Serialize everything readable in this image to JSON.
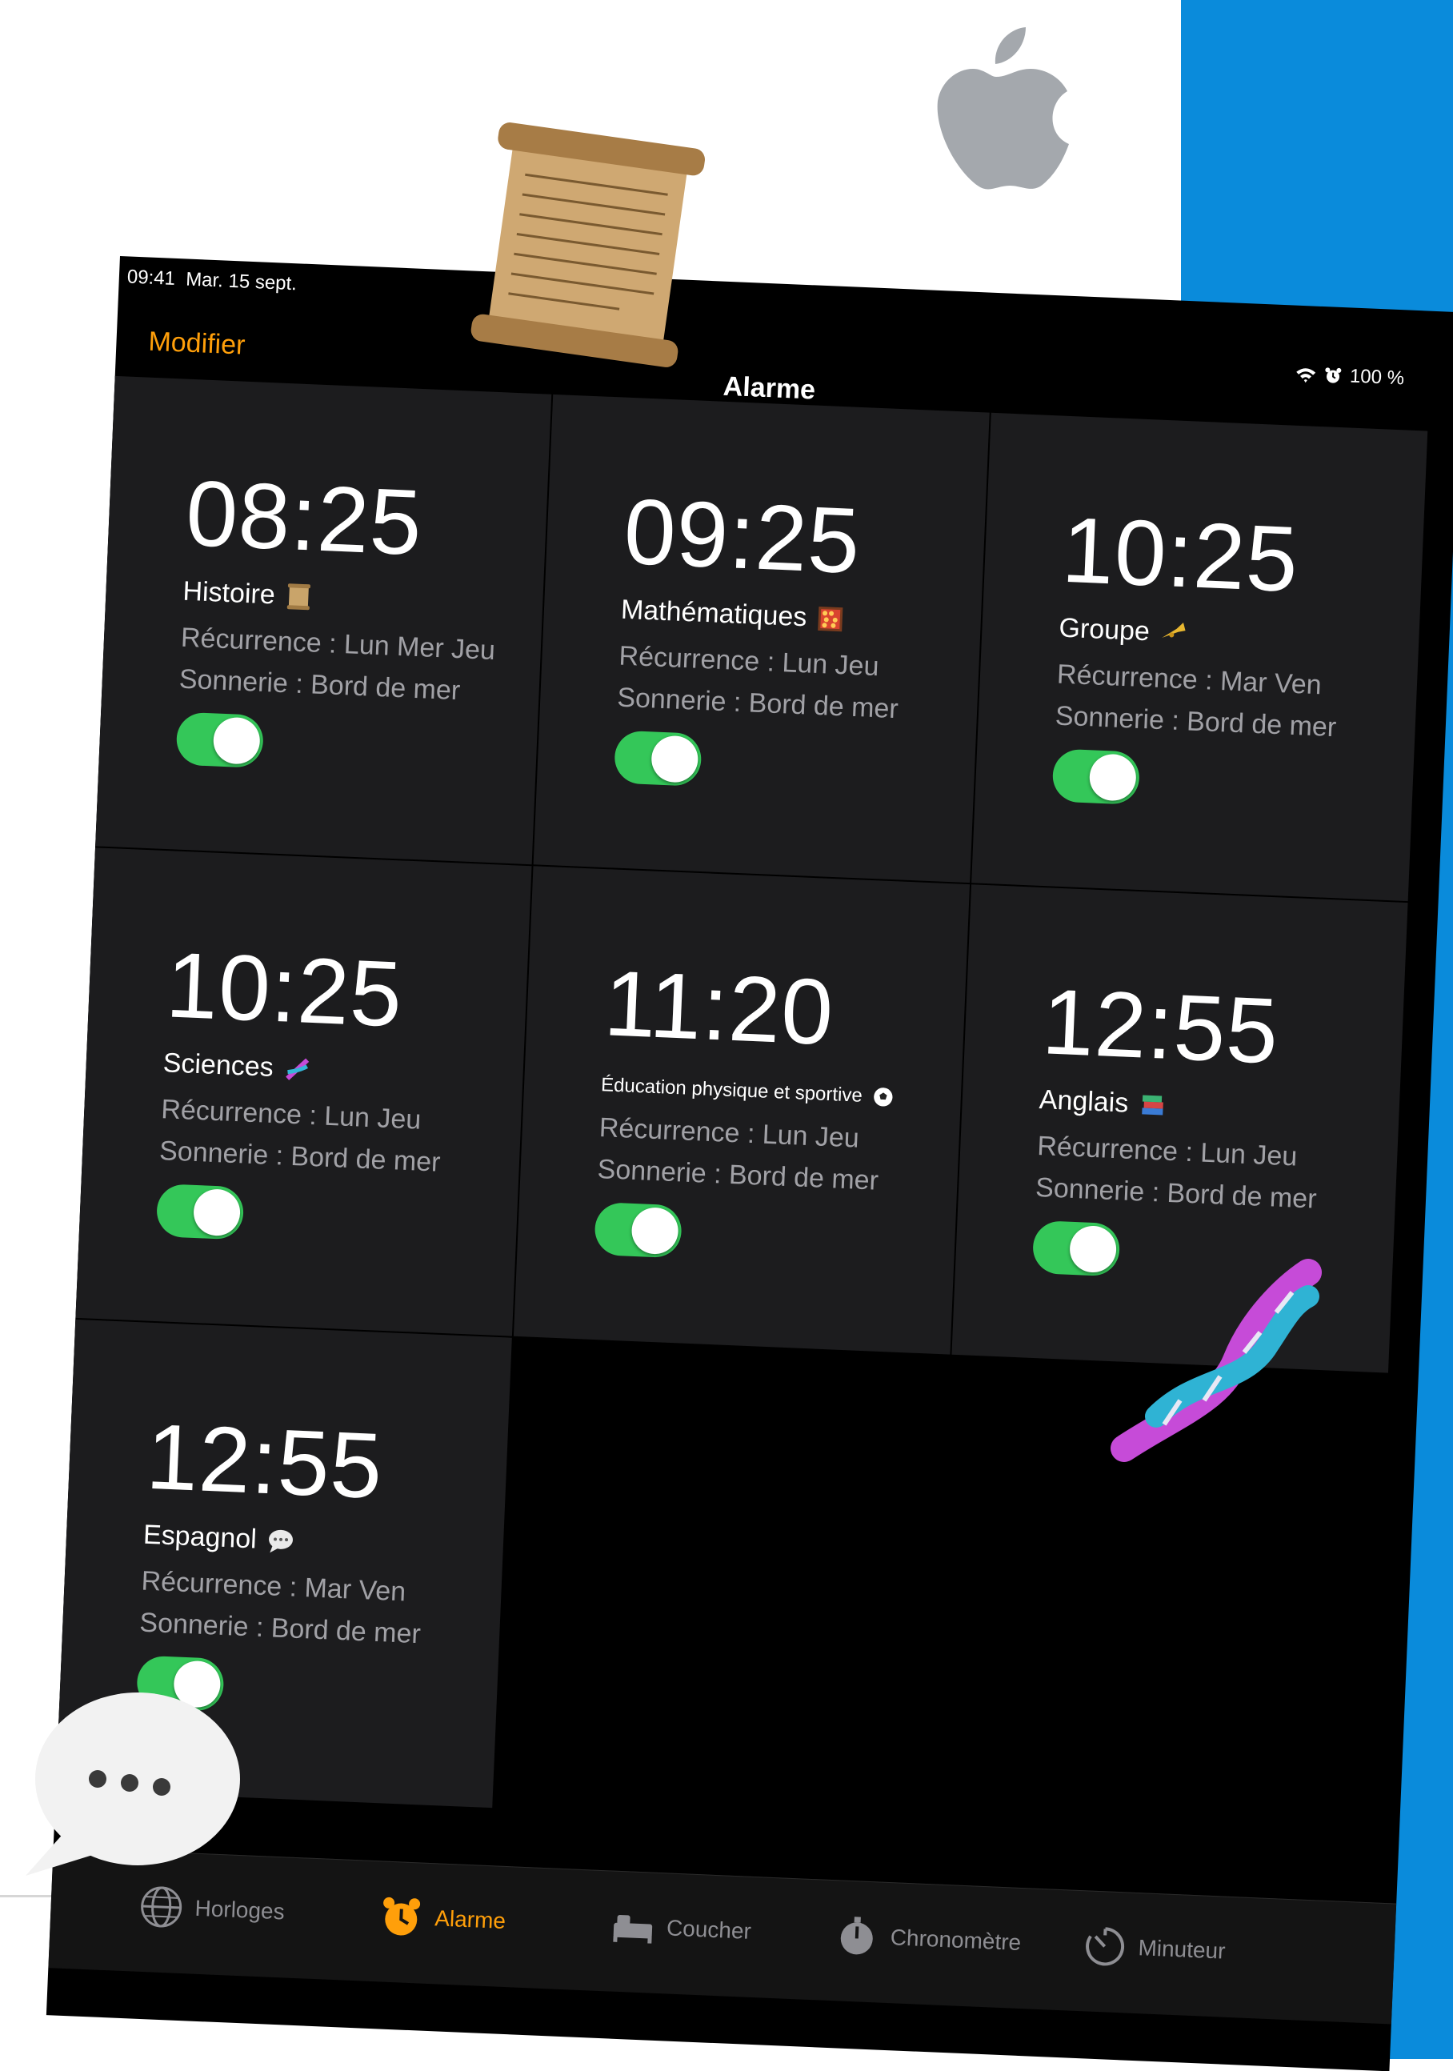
{
  "colors": {
    "accent": "#ff9f0a",
    "toggle_on": "#34c759",
    "card_bg": "#1c1c1e",
    "secondary_text": "#a1a1a6"
  },
  "status": {
    "time": "09:41",
    "date": "Mar. 15 sept.",
    "battery": "100 %",
    "icons": [
      "wifi-icon",
      "alarm-icon"
    ]
  },
  "nav": {
    "edit_label": "Modifier",
    "title": "Alarme",
    "add_label": "+"
  },
  "alarms": [
    {
      "time": "08:25",
      "label": "Histoire",
      "icon": "scroll-icon",
      "recurrence": "Récurrence : Lun Mer Jeu",
      "ringtone": "Sonnerie : Bord de mer",
      "enabled": true
    },
    {
      "time": "09:25",
      "label": "Mathématiques",
      "icon": "abacus-icon",
      "recurrence": "Récurrence : Lun Jeu",
      "ringtone": "Sonnerie : Bord de mer",
      "enabled": true
    },
    {
      "time": "10:25",
      "label": "Groupe",
      "icon": "trumpet-icon",
      "recurrence": "Récurrence : Mar Ven",
      "ringtone": "Sonnerie : Bord de mer",
      "enabled": true
    },
    {
      "time": "10:25",
      "label": "Sciences",
      "icon": "dna-icon",
      "recurrence": "Récurrence : Lun Jeu",
      "ringtone": "Sonnerie : Bord de mer",
      "enabled": true
    },
    {
      "time": "11:20",
      "label": "Éducation physique et sportive",
      "icon": "soccer-ball-icon",
      "recurrence": "Récurrence : Lun Jeu",
      "ringtone": "Sonnerie : Bord de mer",
      "enabled": true
    },
    {
      "time": "12:55",
      "label": "Anglais",
      "icon": "books-icon",
      "recurrence": "Récurrence : Lun Jeu",
      "ringtone": "Sonnerie : Bord de mer",
      "enabled": true
    },
    {
      "time": "12:55",
      "label": "Espagnol",
      "icon": "speech-bubble-icon",
      "recurrence": "Récurrence : Mar Ven",
      "ringtone": "Sonnerie : Bord de mer",
      "enabled": true
    }
  ],
  "tabs": [
    {
      "label": "Horloges",
      "icon": "globe-icon",
      "active": false
    },
    {
      "label": "Alarme",
      "icon": "alarm-clock-icon",
      "active": true
    },
    {
      "label": "Coucher",
      "icon": "bed-icon",
      "active": false
    },
    {
      "label": "Chronomètre",
      "icon": "stopwatch-icon",
      "active": false
    },
    {
      "label": "Minuteur",
      "icon": "timer-icon",
      "active": false
    }
  ],
  "decorations": [
    "apple-logo",
    "scroll-sticker",
    "dna-sticker",
    "speech-bubble-sticker"
  ]
}
